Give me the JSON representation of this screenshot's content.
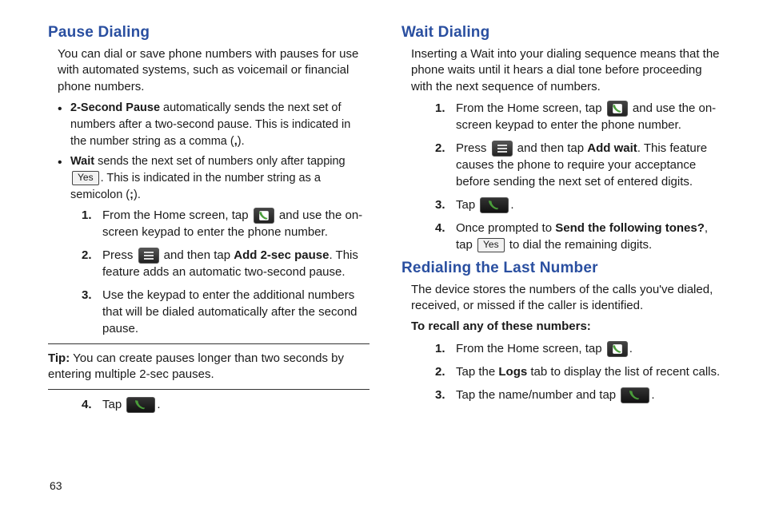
{
  "page_number": "63",
  "icons": {
    "yes": "Yes"
  },
  "left": {
    "h_pause": "Pause Dialing",
    "pause_intro": "You can dial or save phone numbers with pauses for use with automated systems, such as voicemail or financial phone numbers.",
    "bullet1_strong": "2-Second Pause",
    "bullet1_rest": " automatically sends the next set of numbers after a two-second pause. This is indicated in the number string as a comma (",
    "bullet1_comma": ",",
    "bullet1_paren": ").",
    "bullet2_strong": "Wait",
    "bullet2_a": " sends the next set of numbers only after tapping ",
    "bullet2_b": ". This is indicated in the number string as a semicolon (",
    "bullet2_semi": ";",
    "bullet2_c": ").",
    "step1_a": "From the Home screen, tap ",
    "step1_b": " and use the on-screen keypad to enter the phone number.",
    "step2_a": "Press ",
    "step2_b": " and then tap ",
    "step2_strong": "Add 2-sec pause",
    "step2_c": ". This feature adds an automatic two-second pause.",
    "step3": "Use the keypad to enter the additional numbers that will be dialed automatically after the second pause.",
    "tip_label": "Tip:",
    "tip_body": " You can create pauses longer than two seconds by entering multiple 2-sec pauses.",
    "step4_a": "Tap ",
    "step4_b": "."
  },
  "right": {
    "h_wait": "Wait Dialing",
    "wait_intro": "Inserting a Wait into your dialing sequence means that the phone waits until it hears a dial tone before proceeding with the next sequence of numbers.",
    "wstep1_a": "From the Home screen, tap ",
    "wstep1_b": " and use the on-screen keypad to enter the phone number.",
    "wstep2_a": "Press ",
    "wstep2_b": " and then tap ",
    "wstep2_strong": "Add wait",
    "wstep2_c": ". This feature causes the phone to require your acceptance before sending the next set of entered digits.",
    "wstep3_a": "Tap ",
    "wstep3_b": ".",
    "wstep4_a": "Once prompted to ",
    "wstep4_strong": "Send the following tones?",
    "wstep4_b": ", tap ",
    "wstep4_c": " to dial the remaining digits.",
    "h_redial": "Redialing the Last Number",
    "redial_intro": "The device stores the numbers of the calls you've dialed, received, or missed if the caller is identified.",
    "recall_heading": "To recall any of these numbers:",
    "rstep1_a": "From the Home screen, tap ",
    "rstep1_b": ".",
    "rstep2_a": "Tap the ",
    "rstep2_strong": "Logs",
    "rstep2_b": " tab to display the list of recent calls.",
    "rstep3_a": "Tap the name/number and tap ",
    "rstep3_b": "."
  }
}
